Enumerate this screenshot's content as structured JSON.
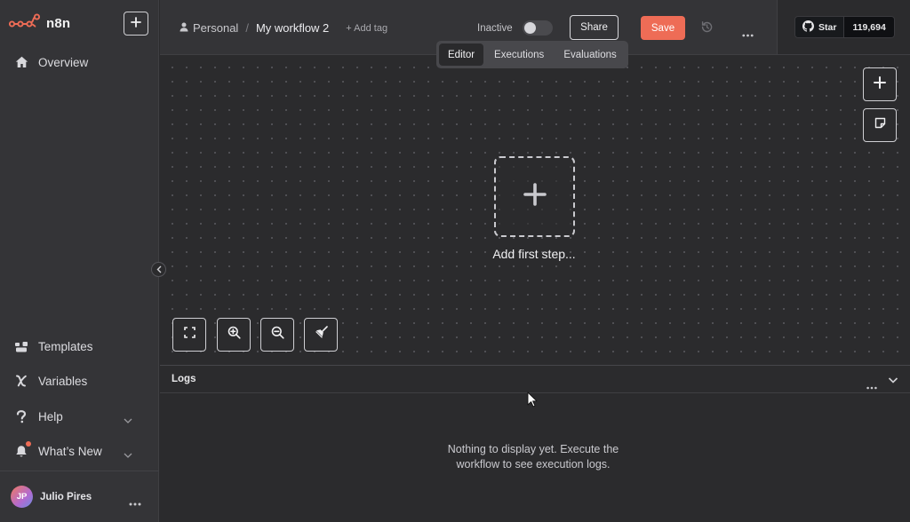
{
  "app": {
    "brand_name": "n8n",
    "accent_color": "#ee6c56"
  },
  "sidebar": {
    "new_button_icon": "plus-icon",
    "items_top": [
      {
        "label": "Overview",
        "icon": "home-icon"
      }
    ],
    "items_bottom": [
      {
        "label": "Templates",
        "icon": "templates-icon"
      },
      {
        "label": "Variables",
        "icon": "variables-icon"
      },
      {
        "label": "Help",
        "icon": "help-icon"
      },
      {
        "label": "What’s New",
        "icon": "bell-icon"
      }
    ],
    "user": {
      "initials": "JP",
      "name": "Julio Pires"
    }
  },
  "header": {
    "breadcrumb_project": "Personal",
    "breadcrumb_separator": "/",
    "workflow_name": "My workflow 2",
    "add_tag_label": "+ Add tag",
    "status_label": "Inactive",
    "active": false,
    "share_label": "Share",
    "save_label": "Save"
  },
  "github": {
    "star_label": "Star",
    "star_count": "119,694"
  },
  "tabs": [
    {
      "label": "Editor",
      "active": true
    },
    {
      "label": "Executions",
      "active": false
    },
    {
      "label": "Evaluations",
      "active": false
    }
  ],
  "canvas": {
    "add_first_step_label": "Add first step..."
  },
  "logs": {
    "title": "Logs",
    "empty_message": "Nothing to display yet. Execute the workflow to see execution logs."
  }
}
